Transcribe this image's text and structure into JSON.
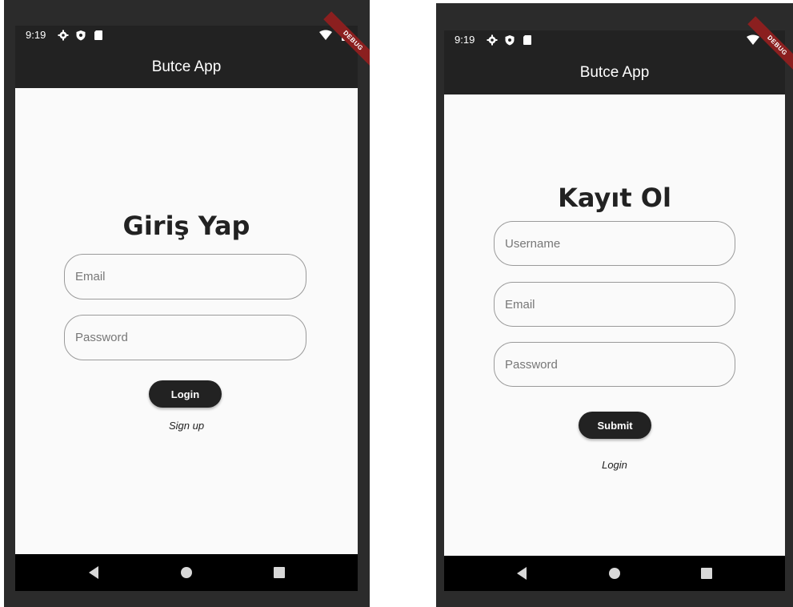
{
  "login_screen": {
    "status": {
      "time": "9:19",
      "icons": [
        "settings-icon",
        "shield-icon",
        "sd-card-icon",
        "wifi-icon",
        "battery-icon"
      ]
    },
    "debug_banner": "DEBUG",
    "app_title": "Butce App",
    "heading": "Giriş Yap",
    "email_placeholder": "Email",
    "password_placeholder": "Password",
    "login_button": "Login",
    "signup_link": "Sign up"
  },
  "signup_screen": {
    "status": {
      "time": "9:19",
      "icons": [
        "settings-icon",
        "shield-icon",
        "sd-card-icon",
        "wifi-icon",
        "battery-icon"
      ]
    },
    "debug_banner": "DEBUG",
    "app_title": "Butce App",
    "heading": "Kayıt Ol",
    "username_placeholder": "Username",
    "email_placeholder": "Email",
    "password_placeholder": "Password",
    "submit_button": "Submit",
    "login_link": "Login"
  },
  "colors": {
    "app_bar": "#222222",
    "background": "#fafafa",
    "button": "#222222",
    "debug_banner": "#8b1f1f"
  }
}
